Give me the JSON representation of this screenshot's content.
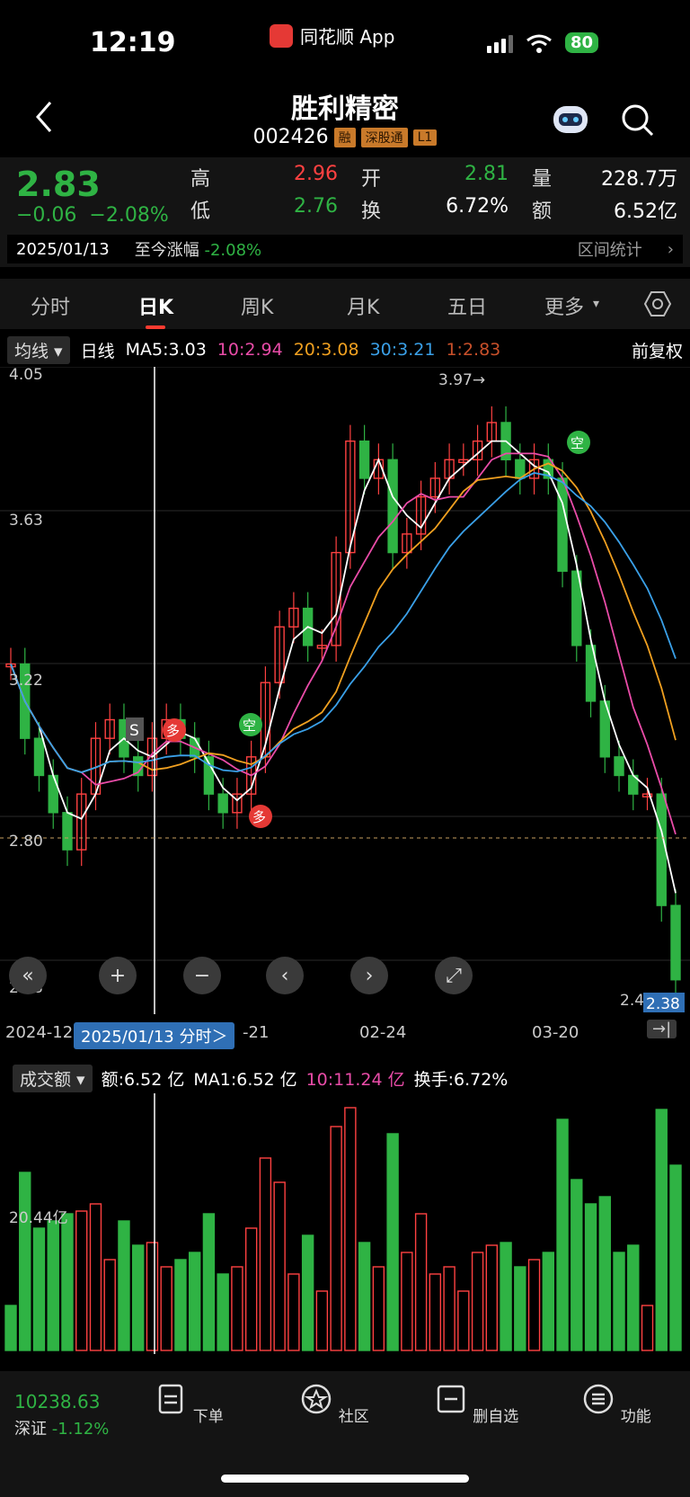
{
  "status": {
    "time": "12:19",
    "app": "同花顺 App",
    "battery": "80"
  },
  "header": {
    "title": "胜利精密",
    "code": "002426",
    "tags": [
      "融",
      "深股通",
      "L1"
    ]
  },
  "quote": {
    "price": "2.83",
    "change": "−0.06",
    "change_pct": "−2.08%",
    "high_label": "高",
    "high": "2.96",
    "open_label": "开",
    "open": "2.81",
    "vol_label": "量",
    "vol": "228.7万",
    "low_label": "低",
    "low": "2.76",
    "turn_label": "换",
    "turn": "6.72%",
    "amt_label": "额",
    "amt": "6.52亿",
    "date": "2025/01/13",
    "since_label": "至今涨幅",
    "since": "-2.08%",
    "stats_label": "区间统计"
  },
  "tabs": [
    "分时",
    "日K",
    "周K",
    "月K",
    "五日",
    "更多",
    "⚙"
  ],
  "ma_row": {
    "selector": "均线",
    "type": "日线",
    "ma5": "MA5:3.03",
    "ma10": "10:2.94",
    "ma20": "20:3.08",
    "ma30": "30:3.21",
    "ma1": "1:2.83",
    "adj": "前复权"
  },
  "chart_data": {
    "type": "candlestick",
    "yticks": [
      "4.05",
      "3.63",
      "3.22",
      "2.80",
      "2.38"
    ],
    "annotations": [
      "3.97→",
      "2.4",
      "2.38",
      "S",
      "多",
      "空"
    ],
    "xticks": [
      "2024-12",
      "-21",
      "02-24",
      "03-20"
    ],
    "crosshair_label": "2025/01/13 分时＞"
  },
  "volume": {
    "selector": "成交额",
    "amt": "额:6.52 亿",
    "ma1": "MA1:6.52 亿",
    "ma10": "10:11.24 亿",
    "turn": "换手:6.72%",
    "ytick": "20.44亿"
  },
  "bottom": {
    "index_value": "10238.63",
    "index_name": "深证",
    "index_chg": "-1.12%",
    "nav": [
      "下单",
      "社区",
      "删自选",
      "功能"
    ]
  },
  "colors": {
    "up": "#ff4141",
    "down": "#2fb344",
    "ma5": "#ffffff",
    "ma10": "#e94ca8",
    "ma20": "#f0a020",
    "ma30": "#3aa0e8"
  }
}
